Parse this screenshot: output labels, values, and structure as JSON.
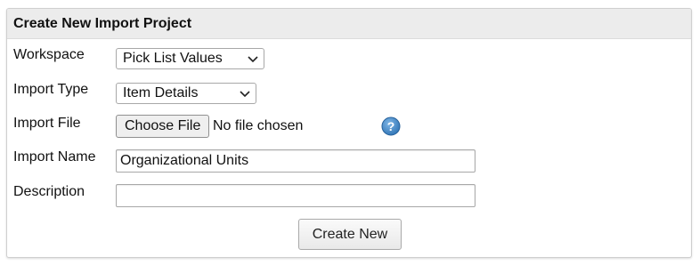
{
  "panel": {
    "title": "Create New Import Project"
  },
  "form": {
    "workspace": {
      "label": "Workspace",
      "selected": "Pick List Values"
    },
    "import_type": {
      "label": "Import Type",
      "selected": "Item Details"
    },
    "import_file": {
      "label": "Import File",
      "button_label": "Choose File",
      "status": "No file chosen",
      "help_icon": "question-circle-icon"
    },
    "import_name": {
      "label": "Import Name",
      "value": "Organizational Units"
    },
    "description": {
      "label": "Description",
      "value": ""
    }
  },
  "actions": {
    "create_label": "Create New"
  },
  "colors": {
    "header_bg": "#ececec",
    "help_icon_blue": "#3d86c6"
  }
}
